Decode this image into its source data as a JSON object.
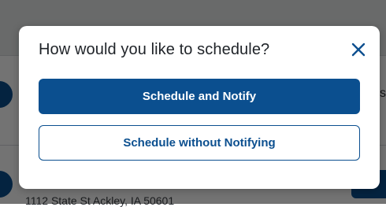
{
  "background": {
    "address_text": "1112 State St Ackley, IA 50601",
    "edge_text": "s"
  },
  "modal": {
    "title": "How would you like to schedule?",
    "close_icon": "close-icon",
    "primary_button_label": "Schedule and Notify",
    "secondary_button_label": "Schedule without Notifying"
  },
  "colors": {
    "accent": "#0b4f8f",
    "overlay": "rgba(0,0,0,0.55)"
  }
}
